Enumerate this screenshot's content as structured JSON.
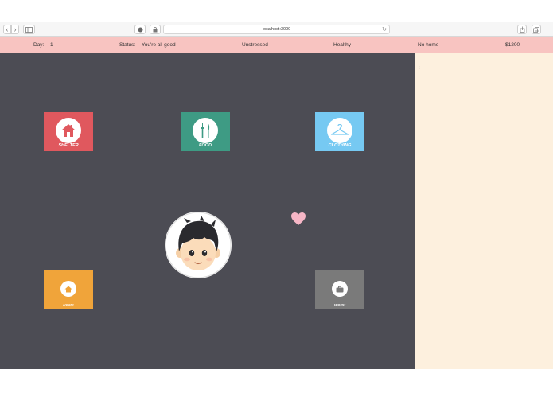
{
  "browser": {
    "url": "localhost:3000",
    "back_icon": "chevron-left-icon",
    "forward_icon": "chevron-right-icon"
  },
  "status": {
    "day_label": "Day:",
    "day_value": "1",
    "status_label": "Status:",
    "status_value": "You're all good",
    "stress": "Unstressed",
    "health": "Healthy",
    "home": "No home",
    "money": "$1200"
  },
  "tiles": {
    "shelter": {
      "label": "SHELTER",
      "color": "#e0585e",
      "icon": "house-icon"
    },
    "food": {
      "label": "FOOD",
      "color": "#3e9b84",
      "icon": "fork-knife-icon"
    },
    "clothing": {
      "label": "CLOTHING",
      "color": "#76c9f2",
      "icon": "hanger-icon"
    },
    "home": {
      "label": "HOME",
      "color": "#f0a43a",
      "icon": "home-icon"
    },
    "work": {
      "label": "WORK",
      "color": "#7a7a7a",
      "icon": "briefcase-icon"
    }
  },
  "side_panel": {
    "text": ":"
  },
  "colors": {
    "game_bg": "#4c4c54",
    "status_bg": "#f8c4c1",
    "side_bg": "#fdf0de",
    "heart": "#f6b6c6"
  }
}
